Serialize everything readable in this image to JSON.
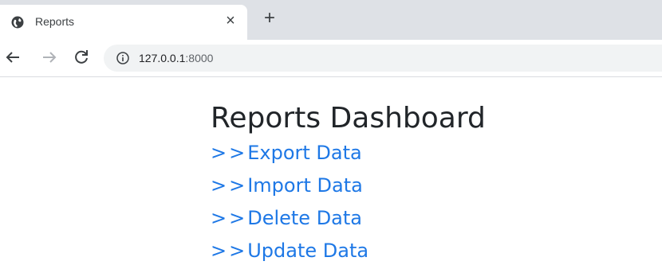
{
  "browser": {
    "tab": {
      "title": "Reports",
      "close_label": "×"
    },
    "new_tab_label": "+",
    "address": {
      "host": "127.0.0.1",
      "port": ":8000"
    }
  },
  "page": {
    "title": "Reports Dashboard",
    "link_prefix": ">>",
    "links": [
      {
        "label": "Export Data"
      },
      {
        "label": "Import Data"
      },
      {
        "label": "Delete Data"
      },
      {
        "label": "Update Data"
      }
    ]
  },
  "colors": {
    "link": "#1e78e6",
    "title": "#212529",
    "tabstrip": "#dee1e6",
    "omnibox": "#f1f3f4"
  },
  "icons": {
    "favicon": "globe-icon",
    "back": "arrow-left-icon",
    "forward": "arrow-right-icon",
    "reload": "reload-icon",
    "info": "info-icon"
  }
}
